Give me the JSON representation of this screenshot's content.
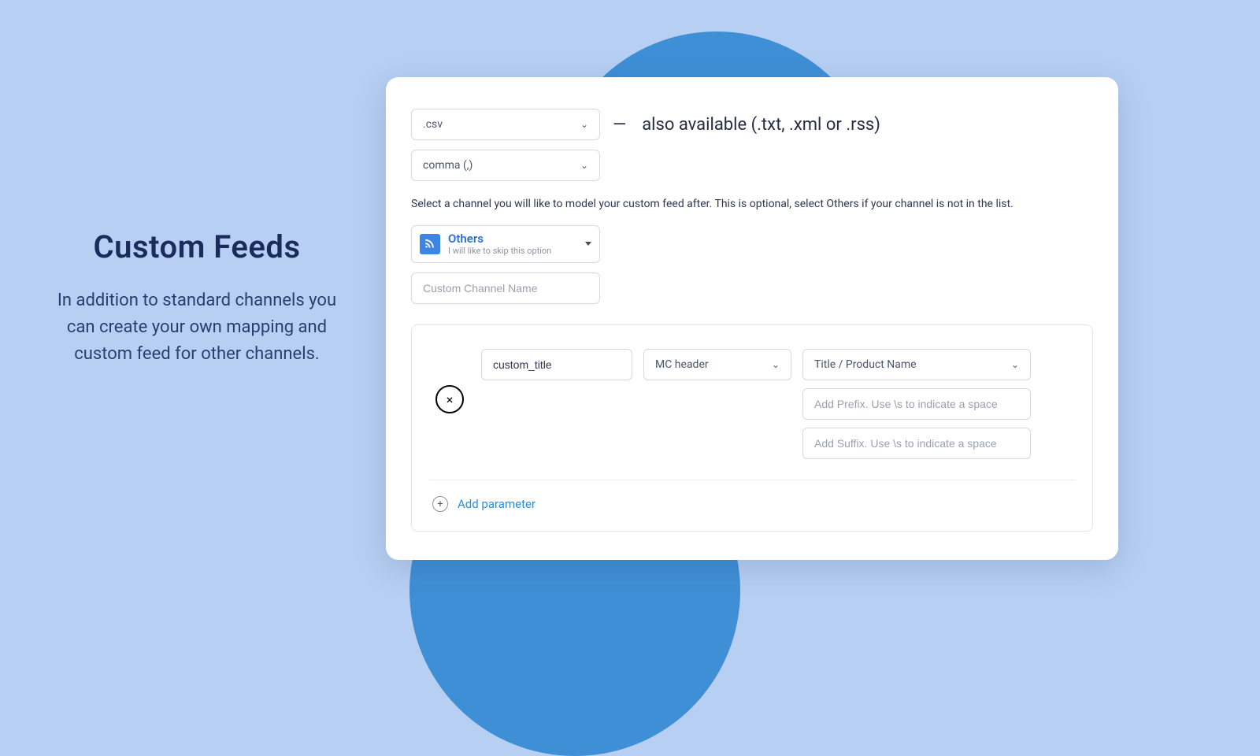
{
  "left": {
    "title": "Custom Feeds",
    "description": "In addition to standard channels you can create your own mapping and custom feed for other channels."
  },
  "format": {
    "selected": ".csv",
    "availableText": "also available (.txt, .xml or .rss)"
  },
  "delimiter": {
    "selected": "comma (,)"
  },
  "channelHelp": "Select a channel you will like to model your custom feed after. This is optional, select Others if your channel is not in the list.",
  "channelSelect": {
    "title": "Others",
    "subtitle": "I will like to skip this option"
  },
  "customChannel": {
    "placeholder": "Custom Channel Name"
  },
  "mapping": {
    "fieldName": "custom_title",
    "headerSelected": "MC header",
    "valueSelected": "Title / Product Name",
    "prefixPlaceholder": "Add Prefix. Use \\s to indicate a space",
    "suffixPlaceholder": "Add Suffix. Use \\s to indicate a space",
    "removeIcon": "×"
  },
  "addParam": {
    "label": "Add parameter",
    "plus": "+"
  },
  "emDash": "—"
}
